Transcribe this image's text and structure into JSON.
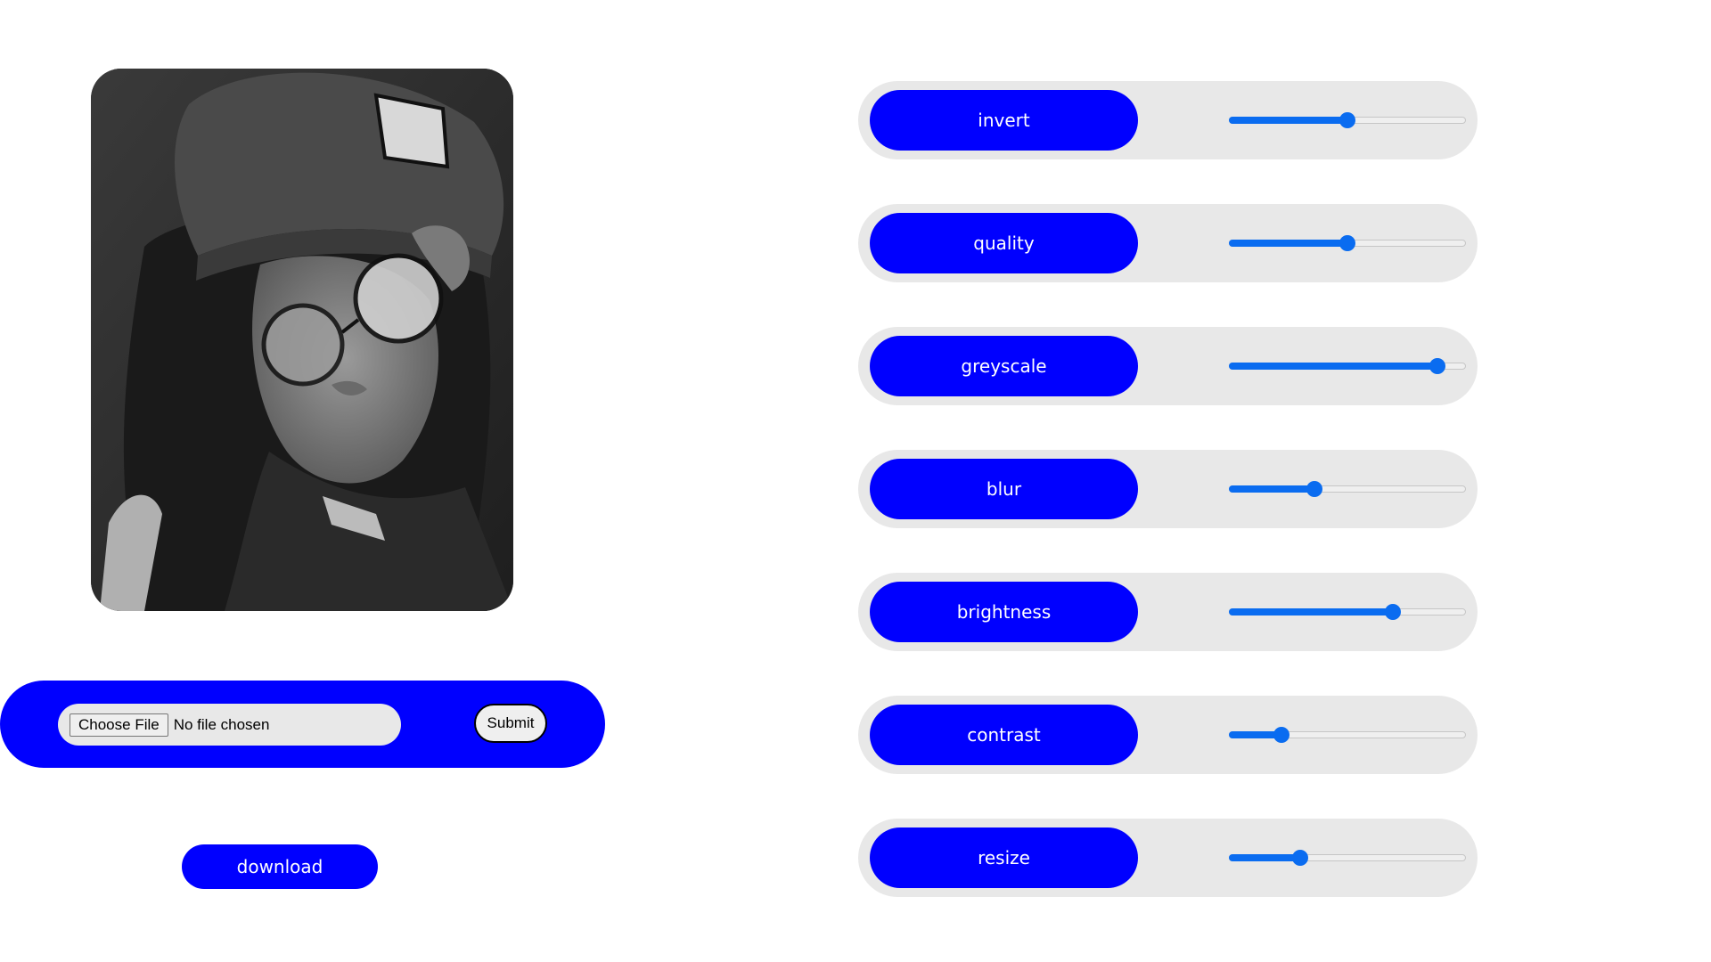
{
  "file_form": {
    "choose_label": "Choose File",
    "status_text": "No file chosen",
    "submit_label": "Submit"
  },
  "download_label": "download",
  "controls": [
    {
      "label": "invert",
      "value": 0.5
    },
    {
      "label": "quality",
      "value": 0.5
    },
    {
      "label": "greyscale",
      "value": 0.88
    },
    {
      "label": "blur",
      "value": 0.36
    },
    {
      "label": "brightness",
      "value": 0.69
    },
    {
      "label": "contrast",
      "value": 0.22
    },
    {
      "label": "resize",
      "value": 0.3
    }
  ],
  "colors": {
    "accent": "#0000ff",
    "slider": "#0a6cf0",
    "panel": "#e8e8e8"
  }
}
